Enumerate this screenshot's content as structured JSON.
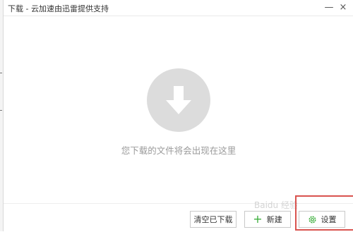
{
  "window": {
    "title": "下载 - 云加速由迅雷提供支持",
    "minimize_glyph": "—",
    "close_glyph": "×"
  },
  "empty_state": {
    "icon": "download-arrow-icon",
    "message": "您下载的文件将会出现在这里"
  },
  "footer": {
    "clear_label": "清空已下载",
    "new_label": "新建",
    "new_icon": "plus-icon",
    "settings_label": "设置",
    "settings_icon": "gear-icon"
  },
  "watermark": {
    "text": "Baidu 经验"
  },
  "colors": {
    "accent_green": "#3cae3c",
    "highlight_red": "#d9534f",
    "empty_circle": "#dcdcdc",
    "muted_text": "#9a9a9a"
  }
}
